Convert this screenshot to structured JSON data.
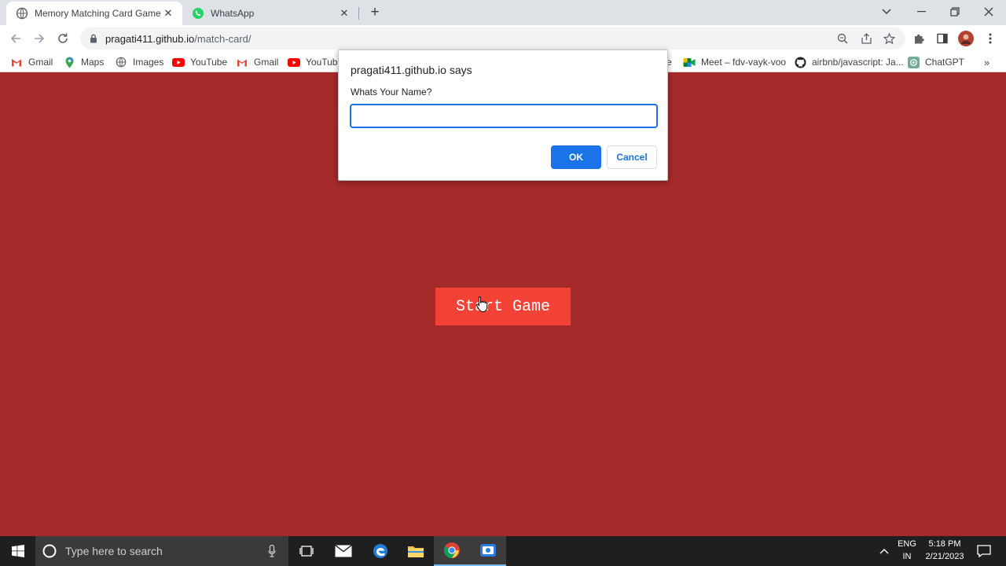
{
  "browser": {
    "tabs": [
      {
        "title": "Memory Matching Card Game",
        "active": true,
        "favicon": "globe-icon"
      },
      {
        "title": "WhatsApp",
        "active": false,
        "favicon": "whatsapp-icon"
      }
    ],
    "url_host": "pragati411.github.io",
    "url_path": "/match-card/"
  },
  "bookmarks": [
    {
      "label": "Gmail",
      "icon": "gmail-icon"
    },
    {
      "label": "Maps",
      "icon": "maps-icon"
    },
    {
      "label": "Images",
      "icon": "globe-icon"
    },
    {
      "label": "YouTube",
      "icon": "youtube-icon"
    },
    {
      "label": "Gmail",
      "icon": "gmail-icon"
    },
    {
      "label": "YouTube",
      "icon": "youtube-icon"
    },
    {
      "label": "e",
      "icon": "none"
    },
    {
      "label": "Meet – fdv-vayk-voo",
      "icon": "meet-icon"
    },
    {
      "label": "airbnb/javascript: Ja...",
      "icon": "github-icon"
    },
    {
      "label": "ChatGPT",
      "icon": "chatgpt-icon"
    }
  ],
  "page": {
    "start_button": "Start Game",
    "background_color": "#a52a2a",
    "button_color": "#f44336"
  },
  "dialog": {
    "title": "pragati411.github.io says",
    "message": "Whats Your Name?",
    "input_value": "",
    "ok_label": "OK",
    "cancel_label": "Cancel"
  },
  "taskbar": {
    "search_placeholder": "Type here to search",
    "language_line1": "ENG",
    "language_line2": "IN",
    "time": "5:18 PM",
    "date": "2/21/2023"
  }
}
